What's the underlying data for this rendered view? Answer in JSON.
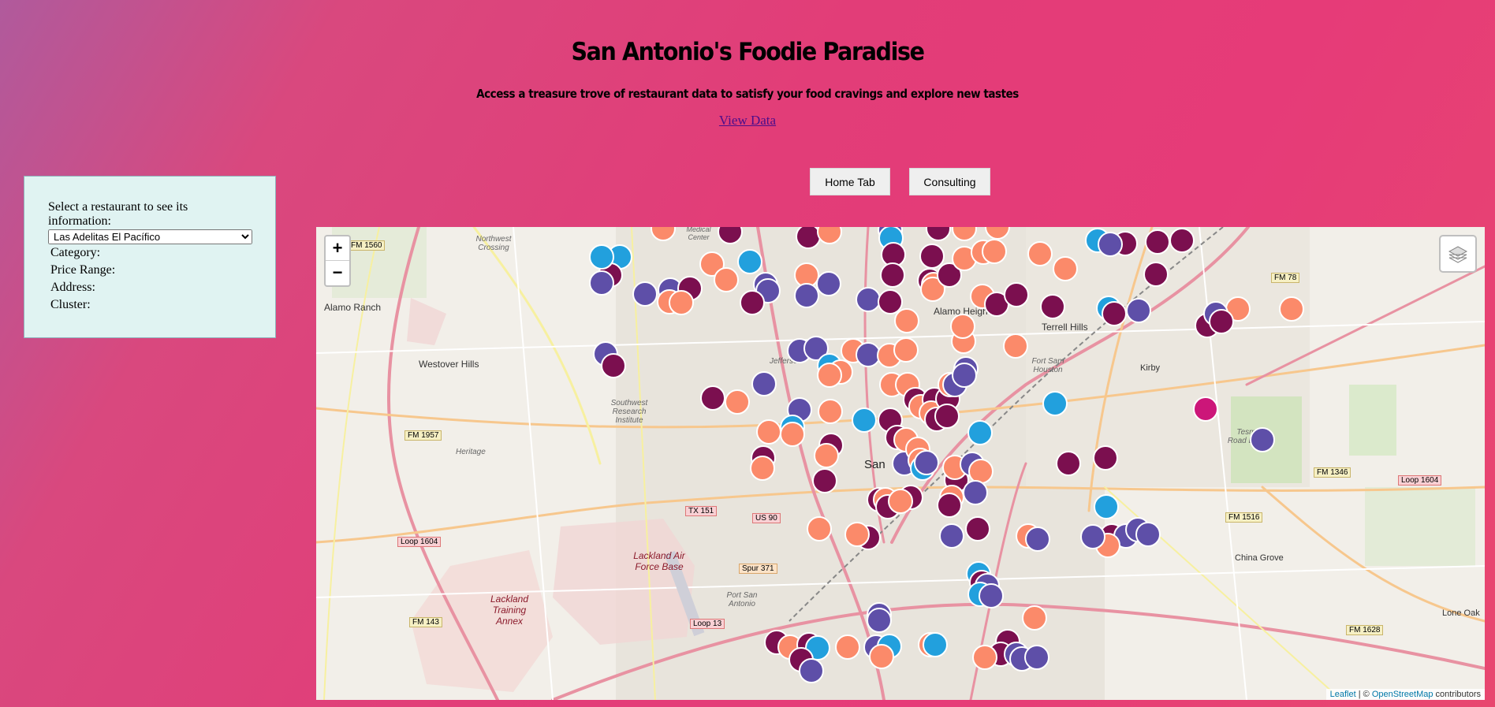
{
  "header": {
    "title": "San Antonio's Foodie Paradise",
    "subtitle": "Access a treasure trove of restaurant data to satisfy your food cravings and explore new tastes",
    "view_link": "View Data"
  },
  "nav": {
    "home_label": "Home Tab",
    "consulting_label": "Consulting"
  },
  "info_panel": {
    "prompt": "Select a restaurant to see its information:",
    "selected_restaurant": "Las Adelitas El Pacífico",
    "category_label": "Category:",
    "price_label": "Price Range:",
    "address_label": "Address:",
    "cluster_label": "Cluster:"
  },
  "map": {
    "zoom_in": "+",
    "zoom_out": "−",
    "attribution_leaflet": "Leaflet",
    "attribution_sep": " | © ",
    "attribution_osm": "OpenStreetMap",
    "attribution_tail": " contributors",
    "cluster_colors": {
      "maroon": "#7b0f4f",
      "salmon": "#fb8a6a",
      "purple": "#5e4fa8",
      "blue": "#22a0dd",
      "magenta": "#cc1679"
    },
    "place_labels": [
      "Northwest Crossing",
      "Alamo Ranch",
      "Westover Hills",
      "Jefferson",
      "Southwest Research Institute",
      "Heritage",
      "San",
      "Lackland Air Force Base",
      "Lackland Training Annex",
      "Port San Antonio",
      "Alamo Heights",
      "Terrell Hills",
      "Fort Sam Houston",
      "Kirby",
      "Tesman Road Landfill",
      "China Grove",
      "Lone Oak",
      "Medical Center"
    ],
    "road_labels": [
      "FM 1560",
      "FM 1957",
      "Loop 1604",
      "FM 143",
      "TX 151",
      "US 90",
      "Spur 371",
      "Loop 13",
      "FM 78",
      "FM 1346",
      "Loop 1604",
      "FM 1516",
      "FM 1628"
    ]
  }
}
